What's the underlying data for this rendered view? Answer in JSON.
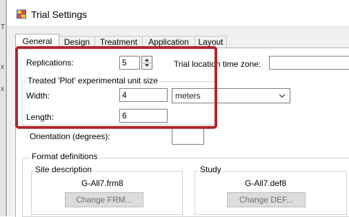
{
  "window": {
    "title": "Trial Settings"
  },
  "left_strip": {
    "marks": [
      "T",
      "x",
      "x"
    ]
  },
  "tabs": [
    {
      "label": "General",
      "active": true
    },
    {
      "label": "Design",
      "active": false
    },
    {
      "label": "Treatment",
      "active": false
    },
    {
      "label": "Application",
      "active": false
    },
    {
      "label": "Layout",
      "active": false
    }
  ],
  "general": {
    "replications_label": "Replications:",
    "replications_value": "5",
    "timezone_label": "Trial location time zone:",
    "timezone_value": "",
    "plot_group_title": "Treated 'Plot' experimental unit size",
    "width_label": "Width:",
    "width_value": "4",
    "unit_selected": "meters",
    "length_label": "Length:",
    "length_value": "6",
    "orientation_label": "Orientation (degrees):",
    "orientation_value": ""
  },
  "format": {
    "group_title": "Format definitions",
    "site_title": "Site description",
    "site_file": "G-All7.frm8",
    "site_button": "Change FRM...",
    "study_title": "Study",
    "study_file": "G-All7.def8",
    "study_button": "Change DEF..."
  },
  "colors": {
    "highlight": "#b3262a",
    "disabled_button_text": "#6d6d6d"
  },
  "icons": {
    "app": "app-icon",
    "spin": "spin-arrows-icon",
    "dropdown": "chevron-down-icon"
  }
}
